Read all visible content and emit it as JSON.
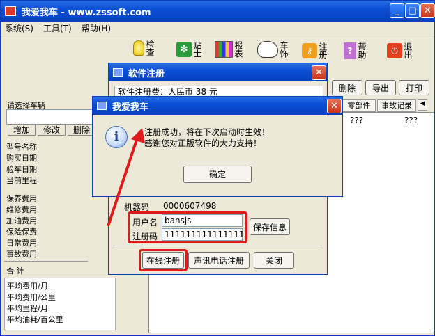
{
  "main_window": {
    "title": "我爱我车 - www.zssoft.com",
    "menu": [
      "系统(S)",
      "工具(T)",
      "帮助(H)"
    ],
    "toolbar": [
      {
        "label": "检查",
        "icon": "bulb-icon"
      },
      {
        "label": "贴士",
        "icon": "tips-icon"
      },
      {
        "label": "报表",
        "icon": "report-icon"
      },
      {
        "label": "车饰",
        "icon": "dog-icon"
      },
      {
        "label": "注册",
        "icon": "key-icon"
      },
      {
        "label": "帮助",
        "icon": "help-icon"
      },
      {
        "label": "退出",
        "icon": "exit-icon"
      }
    ],
    "left_panel": {
      "select_label": "请选择车辆",
      "buttons": [
        "增加",
        "修改",
        "删除"
      ],
      "info_labels": [
        "型号名称",
        "购买日期",
        "验车日期",
        "当前里程"
      ],
      "expense_labels": [
        "保养费用",
        "维修费用",
        "加油费用",
        "保险保费",
        "日常费用",
        "事故费用"
      ],
      "total_label": "合  计",
      "avg_labels": [
        "平均费用/月",
        "平均费用/公里",
        "平均里程/月",
        "平均油耗/百公里"
      ]
    },
    "right_panel": {
      "action_buttons": [
        "删除",
        "导出",
        "打印"
      ],
      "tabs": [
        "零部件",
        "事故记录"
      ],
      "cells": [
        "???",
        "???",
        "???"
      ]
    }
  },
  "register_dialog": {
    "title": "软件注册",
    "fee_text": "软件注册费：人民币 38 元",
    "machine_code_label": "机器码",
    "machine_code": "0000607498",
    "username_label": "用户名",
    "username": "bansjs",
    "regcode_label": "注册码",
    "regcode": "111111111111111",
    "save_button": "保存信息",
    "online_button": "在线注册",
    "phone_button": "声讯电话注册",
    "close_button": "关闭"
  },
  "message_box": {
    "title": "我爱我车",
    "line1": "注册成功，将在下次启动时生效！",
    "line2": "感谢您对正版软件的大力支持！",
    "ok_button": "确定"
  }
}
